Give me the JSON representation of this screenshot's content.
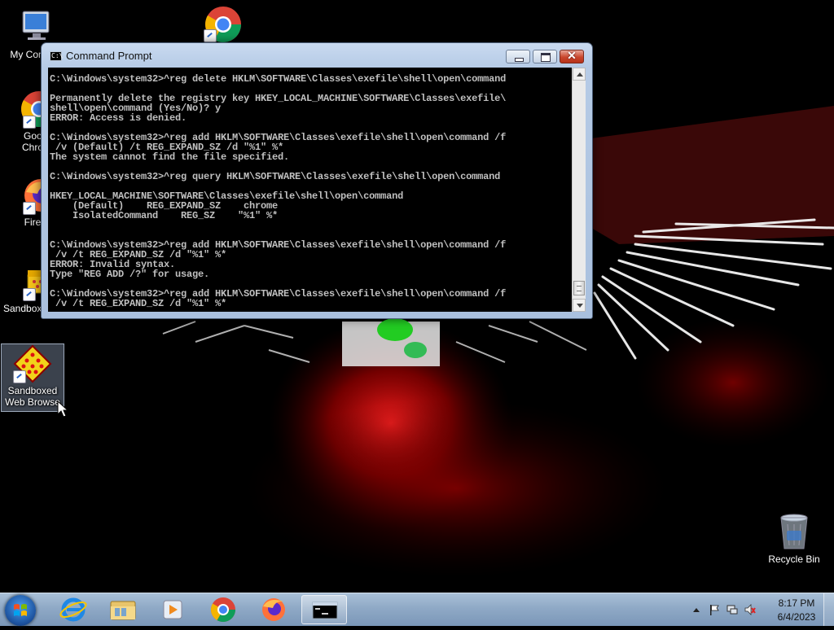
{
  "desktop": {
    "icons": [
      {
        "label": "My Comp",
        "name": "computer"
      },
      {
        "label": "Google Chrome",
        "name": "chrome"
      },
      {
        "label": "Firefox",
        "name": "firefox"
      },
      {
        "label": "Sandbox",
        "name": "sandbox"
      },
      {
        "label": "Sandboxed Web Browser",
        "name": "sandboxed-web-browser"
      },
      {
        "label": "",
        "name": "chrome-top"
      },
      {
        "label": "Recycle Bin",
        "name": "recycle-bin"
      }
    ],
    "visible_labels": {
      "computer": "My Comp",
      "chrome_line1": "Googl",
      "chrome_line2": "Chrom",
      "firefox": "Firefo",
      "sandbox": "Sandbox",
      "sandboxed_line1": "Sandboxed",
      "sandboxed_line2": "Web Browse",
      "recycle": "Recycle Bin"
    }
  },
  "cmd": {
    "title": "Command Prompt",
    "icon_text": "C:\\",
    "close_glyph": "✕",
    "output": "C:\\Windows\\system32>^reg delete HKLM\\SOFTWARE\\Classes\\exefile\\shell\\open\\command\n\nPermanently delete the registry key HKEY_LOCAL_MACHINE\\SOFTWARE\\Classes\\exefile\\\nshell\\open\\command (Yes/No)? y\nERROR: Access is denied.\n\nC:\\Windows\\system32>^reg add HKLM\\SOFTWARE\\Classes\\exefile\\shell\\open\\command /f\n /v (Default) /t REG_EXPAND_SZ /d \"%1\" %*\nThe system cannot find the file specified.\n\nC:\\Windows\\system32>^reg query HKLM\\SOFTWARE\\Classes\\exefile\\shell\\open\\command\n\nHKEY_LOCAL_MACHINE\\SOFTWARE\\Classes\\exefile\\shell\\open\\command\n    (Default)    REG_EXPAND_SZ    chrome\n    IsolatedCommand    REG_SZ    \"%1\" %*\n\n\nC:\\Windows\\system32>^reg add HKLM\\SOFTWARE\\Classes\\exefile\\shell\\open\\command /f\n /v /t REG_EXPAND_SZ /d \"%1\" %*\nERROR: Invalid syntax.\nType \"REG ADD /?\" for usage.\n\nC:\\Windows\\system32>^reg add HKLM\\SOFTWARE\\Classes\\exefile\\shell\\open\\command /f\n /v /t REG_EXPAND_SZ /d \"%1\" %*"
  },
  "taskbar": {
    "items": [
      "start",
      "internet-explorer",
      "file-explorer",
      "media-player",
      "chrome",
      "firefox",
      "command-prompt"
    ],
    "active_item": "command-prompt",
    "clock_time": "8:17 PM",
    "clock_date": "6/4/2023"
  }
}
